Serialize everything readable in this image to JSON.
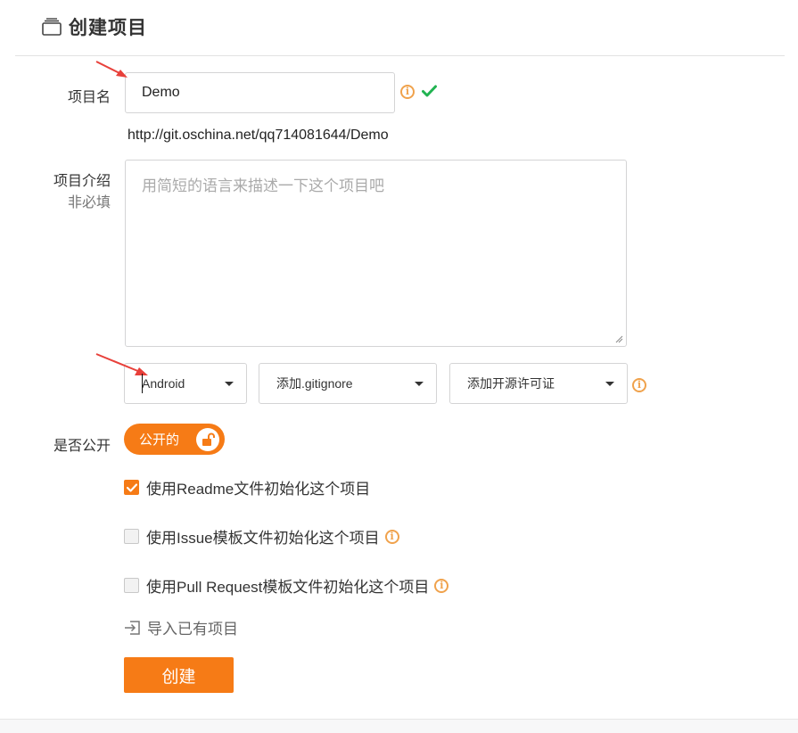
{
  "header": {
    "title": "创建项目",
    "icon": "folder-icon"
  },
  "form": {
    "name_label": "项目名",
    "name_value": "Demo",
    "url_text": "http://git.oschina.net/qq714081644/Demo",
    "desc_label": "项目介绍",
    "desc_sublabel": "非必填",
    "desc_placeholder": "用简短的语言来描述一下这个项目吧",
    "language_select": "Android",
    "gitignore_select": "添加.gitignore",
    "license_select": "添加开源许可证",
    "public_label": "是否公开",
    "public_toggle": "公开的",
    "public_on": true
  },
  "options": [
    {
      "label": "使用Readme文件初始化这个项目",
      "checked": true
    },
    {
      "label": "使用Issue模板文件初始化这个项目",
      "checked": false
    },
    {
      "label": "使用Pull Request模板文件初始化这个项目",
      "checked": false
    }
  ],
  "import_link": "导入已有项目",
  "create_button": "创建",
  "colors": {
    "accent": "#f67b16",
    "info": "#f0a24c",
    "success": "#21b351",
    "annotation": "#e8403a"
  }
}
